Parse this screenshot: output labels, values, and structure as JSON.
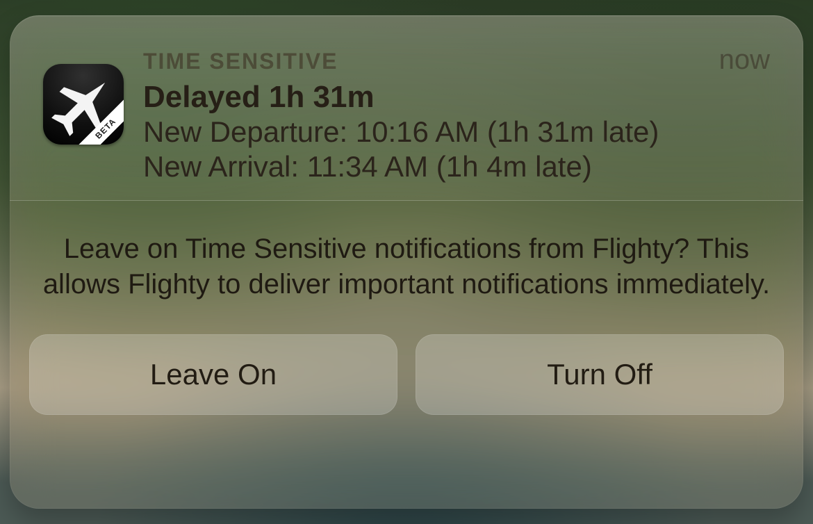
{
  "notification": {
    "app_name": "Flighty",
    "icon_ribbon": "BETA",
    "badge": "TIME SENSITIVE",
    "timestamp": "now",
    "title": "Delayed 1h 31m",
    "lines": [
      "New Departure: 10:16 AM (1h 31m late)",
      "New Arrival: 11:34 AM (1h 4m late)"
    ]
  },
  "prompt": {
    "text": "Leave on Time Sensitive notifications from Flighty? This allows Flighty to deliver important notifications immediately.",
    "buttons": {
      "leave_on": "Leave On",
      "turn_off": "Turn Off"
    }
  }
}
